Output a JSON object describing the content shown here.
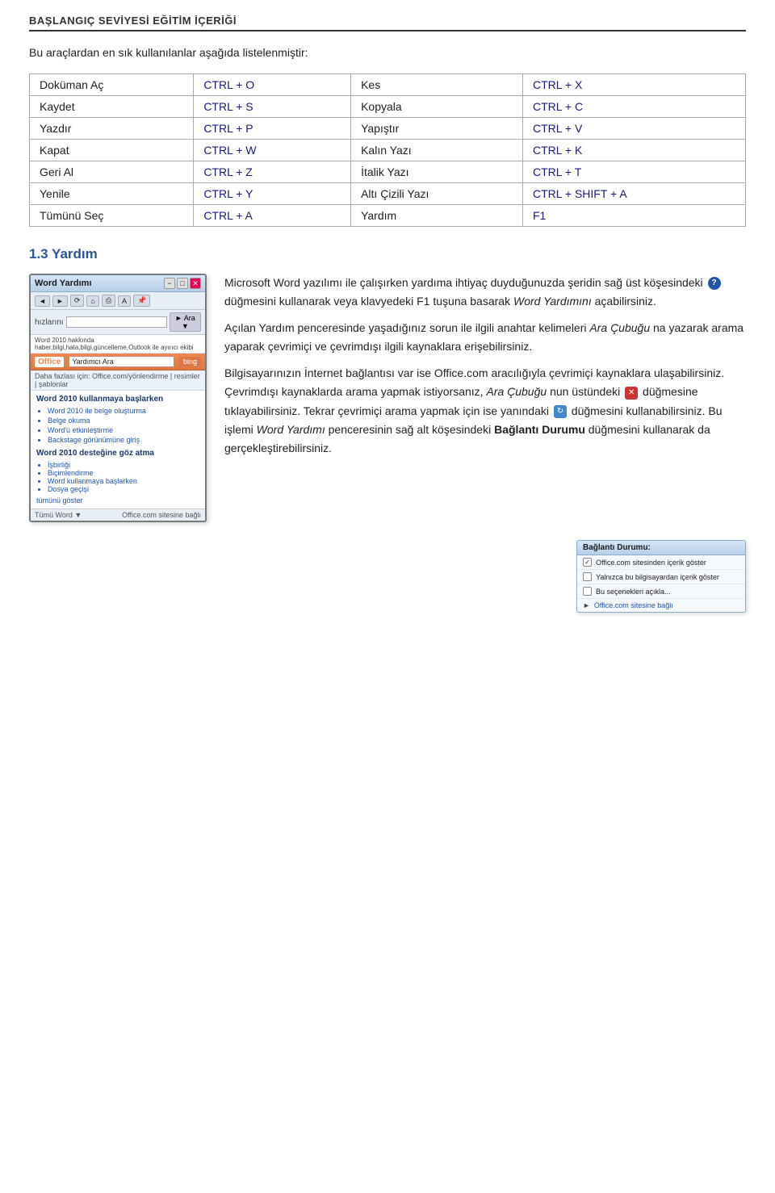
{
  "header": {
    "title": "BAŞLANGIÇ SEVİYESİ EĞİTİM İÇERİĞİ"
  },
  "intro": {
    "text": "Bu araçlardan en sık kullanılanlar aşağıda listelenmiştir:"
  },
  "shortcuts": [
    {
      "action": "Doküman Aç",
      "keys": "CTRL + O",
      "action2": "Kes",
      "keys2": "CTRL + X"
    },
    {
      "action": "Kaydet",
      "keys": "CTRL + S",
      "action2": "Kopyala",
      "keys2": "CTRL + C"
    },
    {
      "action": "Yazdır",
      "keys": "CTRL + P",
      "action2": "Yapıştır",
      "keys2": "CTRL + V"
    },
    {
      "action": "Kapat",
      "keys": "CTRL + W",
      "action2": "Kalın Yazı",
      "keys2": "CTRL + K"
    },
    {
      "action": "Geri Al",
      "keys": "CTRL + Z",
      "action2": "İtalik Yazı",
      "keys2": "CTRL + T"
    },
    {
      "action": "Yenile",
      "keys": "CTRL + Y",
      "action2": "Altı Çizili Yazı",
      "keys2": "CTRL + SHIFT + A"
    },
    {
      "action": "Tümünü Seç",
      "keys": "CTRL + A",
      "action2": "Yardım",
      "keys2": "F1"
    }
  ],
  "section13": {
    "title": "1.3 Yardım"
  },
  "word_help_window": {
    "title": "Word Yardımı",
    "toolbar_buttons": [
      "◄",
      "►",
      "⟳",
      "🏠",
      "🖨",
      "A"
    ],
    "search_label": "hızlarını",
    "search_btn": "► Ara ▼",
    "breadcrumb": "Word 2010 hakkında haber,bilgi,hata,bilgi,güncelleme,Outlook ile ayırıcı ekibi",
    "office_logo": "Office",
    "bing_search_placeholder": "Yardımcı Ara",
    "links": "Daha fazlası için: Office.com/yönlendirme | resimler | şablonlar",
    "section1_title": "Word 2010 kullanmaya başlarken",
    "section1_items": [
      "Word 2010 ile belge oluşturma",
      "Belge okuma",
      "Word'ü etkinleştirme",
      "Backstage görünümüne giriş"
    ],
    "section2_title": "Word 2010 desteğine göz atma",
    "section2_items": [
      "İşbirliği",
      "Biçimlendirme",
      "Word kullanmaya başlarken",
      "Dosya geçişi"
    ],
    "show_all": "tümünü göster",
    "footer_left": "Tümü Word ▼",
    "footer_right": "Office.com sitesine bağlı"
  },
  "text_blocks": {
    "para1": "Microsoft Word yazılımı ile çalışırken yardıma ihtiyaç duyduğunuzda şeridin sağ üst köşesindeki",
    "para1b": "düğmesini kullanarak veya klavyedeki F1 tuşuna basarak",
    "para1_italic": "Word Yardımını",
    "para1c": "açabilirsiniz.",
    "para2": "Açılan Yardım penceresinde yaşadığınız sorun ile ilgili anahtar kelimeleri",
    "para2_italic": "Ara Çubuğu",
    "para2b": "na yazarak arama yaparak çevrimiçi ve çevrimdışı ilgili kaynaklara erişebilirsiniz.",
    "para3": "Bilgisayarınızın İnternet bağlantısı var ise Office.com aracılığıyla çevrimiçi kaynaklara ulaşabilirsiniz. Çevrimdışı kaynaklarda arama yapmak istiyorsanız,",
    "para3_italic": "Ara Çubuğu",
    "para3b": "nun üstündeki",
    "para3c": "düğmesine tıklayabilirsiniz. Tekrar çevrimiçi arama yapmak için ise yanındaki",
    "para3d": "düğmesini kullanabilirsiniz. Bu işlemi",
    "para3_italic2": "Word Yardımı",
    "para3e": "penceresinin sağ alt köşesindeki",
    "para3_bold": "Bağlantı Durumu",
    "para3f": "düğmesini kullanarak da gerçekleştirebilirsiniz."
  },
  "baglanti_popup": {
    "title": "Bağlantı Durumu:",
    "items": [
      "Office.com sitesinden içerik göster",
      "Yalnızca bu bilgisayardan içerik göster",
      "Bu seçenekleri açıkla..."
    ],
    "last_item": "Office.com sitesine bağlı"
  }
}
